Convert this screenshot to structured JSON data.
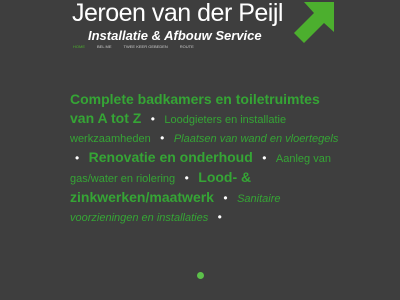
{
  "header": {
    "brand": "Jeroen van der Peijl",
    "tagline": "Installatie & Afbouw Service"
  },
  "nav": {
    "items": [
      {
        "label": "Home",
        "active": true
      },
      {
        "label": "Bel me"
      },
      {
        "label": "Twee keer gebeden"
      },
      {
        "label": "Route"
      }
    ]
  },
  "content": {
    "item1": "Complete badkamers en toiletruimtes van A tot Z",
    "item2": "Loodgieters en installatie werkzaamheden",
    "item3": "Plaatsen van wand en vloertegels",
    "item4": "Renovatie en onderhoud",
    "item5": "Aanleg van gas/water en riolering",
    "item6": "Lood- & zinkwerken/maatwerk",
    "item7": "Sanitaire voorzieningen en installaties",
    "bullet": "•"
  },
  "slider": {
    "indicator_color": "#5cc04a"
  },
  "colors": {
    "background": "#3e3e3e",
    "accent_green": "#35a535",
    "logo_green": "#4caf2e",
    "text_white": "#ffffff"
  },
  "icons": {
    "logo": "arrow-up-right-icon"
  }
}
